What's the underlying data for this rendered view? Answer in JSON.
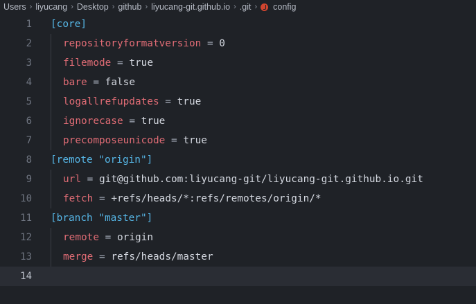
{
  "breadcrumb": {
    "items": [
      "Users",
      "liyucang",
      "Desktop",
      "github",
      "liyucang-git.github.io",
      ".git"
    ],
    "file": "config",
    "file_icon": "git-config-icon",
    "separator_icon": "chevron-right-icon"
  },
  "editor": {
    "lines": [
      {
        "number": "1",
        "section": "[core]"
      },
      {
        "number": "2",
        "key": "repositoryformatversion",
        "op": "=",
        "value": "0"
      },
      {
        "number": "3",
        "key": "filemode",
        "op": "=",
        "value": "true"
      },
      {
        "number": "4",
        "key": "bare",
        "op": "=",
        "value": "false"
      },
      {
        "number": "5",
        "key": "logallrefupdates",
        "op": "=",
        "value": "true"
      },
      {
        "number": "6",
        "key": "ignorecase",
        "op": "=",
        "value": "true"
      },
      {
        "number": "7",
        "key": "precomposeunicode",
        "op": "=",
        "value": "true"
      },
      {
        "number": "8",
        "section": "[remote \"origin\"]"
      },
      {
        "number": "9",
        "key": "url",
        "op": "=",
        "value": "git@github.com:liyucang-git/liyucang-git.github.io.git"
      },
      {
        "number": "10",
        "key": "fetch",
        "op": "=",
        "value": "+refs/heads/*:refs/remotes/origin/*"
      },
      {
        "number": "11",
        "section": "[branch \"master\"]"
      },
      {
        "number": "12",
        "key": "remote",
        "op": "=",
        "value": "origin"
      },
      {
        "number": "13",
        "key": "merge",
        "op": "=",
        "value": "refs/heads/master"
      },
      {
        "number": "14",
        "current": true
      }
    ]
  },
  "colors": {
    "background": "#1f2227",
    "section": "#56b6e6",
    "key": "#e06c75",
    "value": "#d4d8e0",
    "line_number": "#6f7581",
    "current_line": "#2a2d34"
  }
}
